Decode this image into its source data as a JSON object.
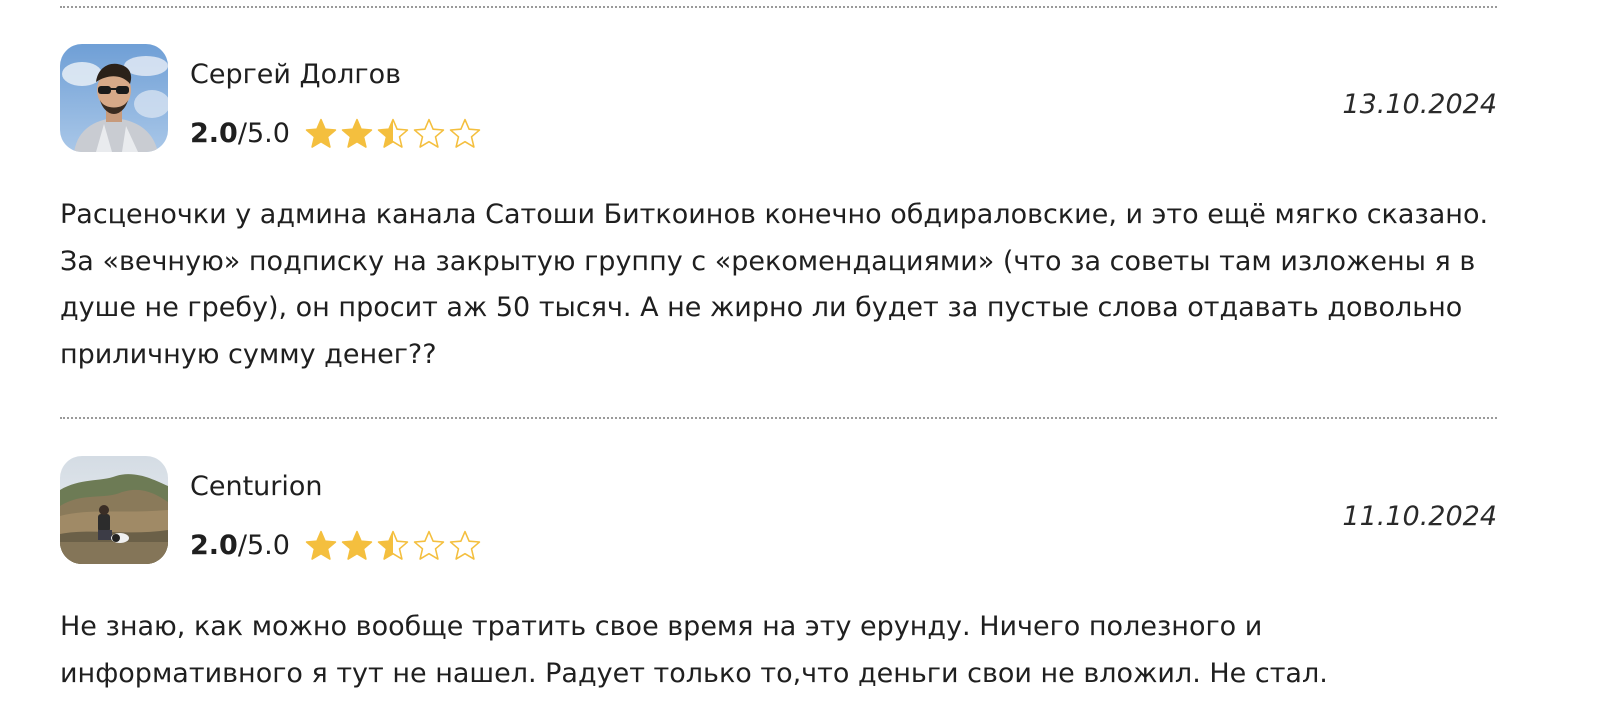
{
  "reviews": [
    {
      "author": "Сергей Долгов",
      "rating_value": "2.0",
      "rating_max": "/5.0",
      "rating": 2.5,
      "rating_scale": 5,
      "date": "13.10.2024",
      "text": "Расценочки у админа канала Сатоши Биткоинов конечно обдираловские, и это ещё мягко сказано. За «вечную» подписку на закрытую группу с «рекомендациями» (что за советы там изложены я в душе не гребу), он просит аж 50 тысяч. А не жирно ли будет за пустые слова отдавать довольно приличную сумму денег??"
    },
    {
      "author": "Centurion",
      "rating_value": "2.0",
      "rating_max": "/5.0",
      "rating": 2.5,
      "rating_scale": 5,
      "date": "11.10.2024",
      "text": "Не знаю, как можно вообще тратить свое время на эту ерунду. Ничего полезного и информативного я тут не нашел. Радует только то,что деньги свои не вложил. Не стал."
    }
  ],
  "colors": {
    "star": "#f4bf3e",
    "divider": "#9a9a9a",
    "text": "#1f1f1f"
  },
  "icons": {
    "star_full": "star-filled-icon",
    "star_half": "star-half-icon",
    "star_empty": "star-outline-icon"
  }
}
